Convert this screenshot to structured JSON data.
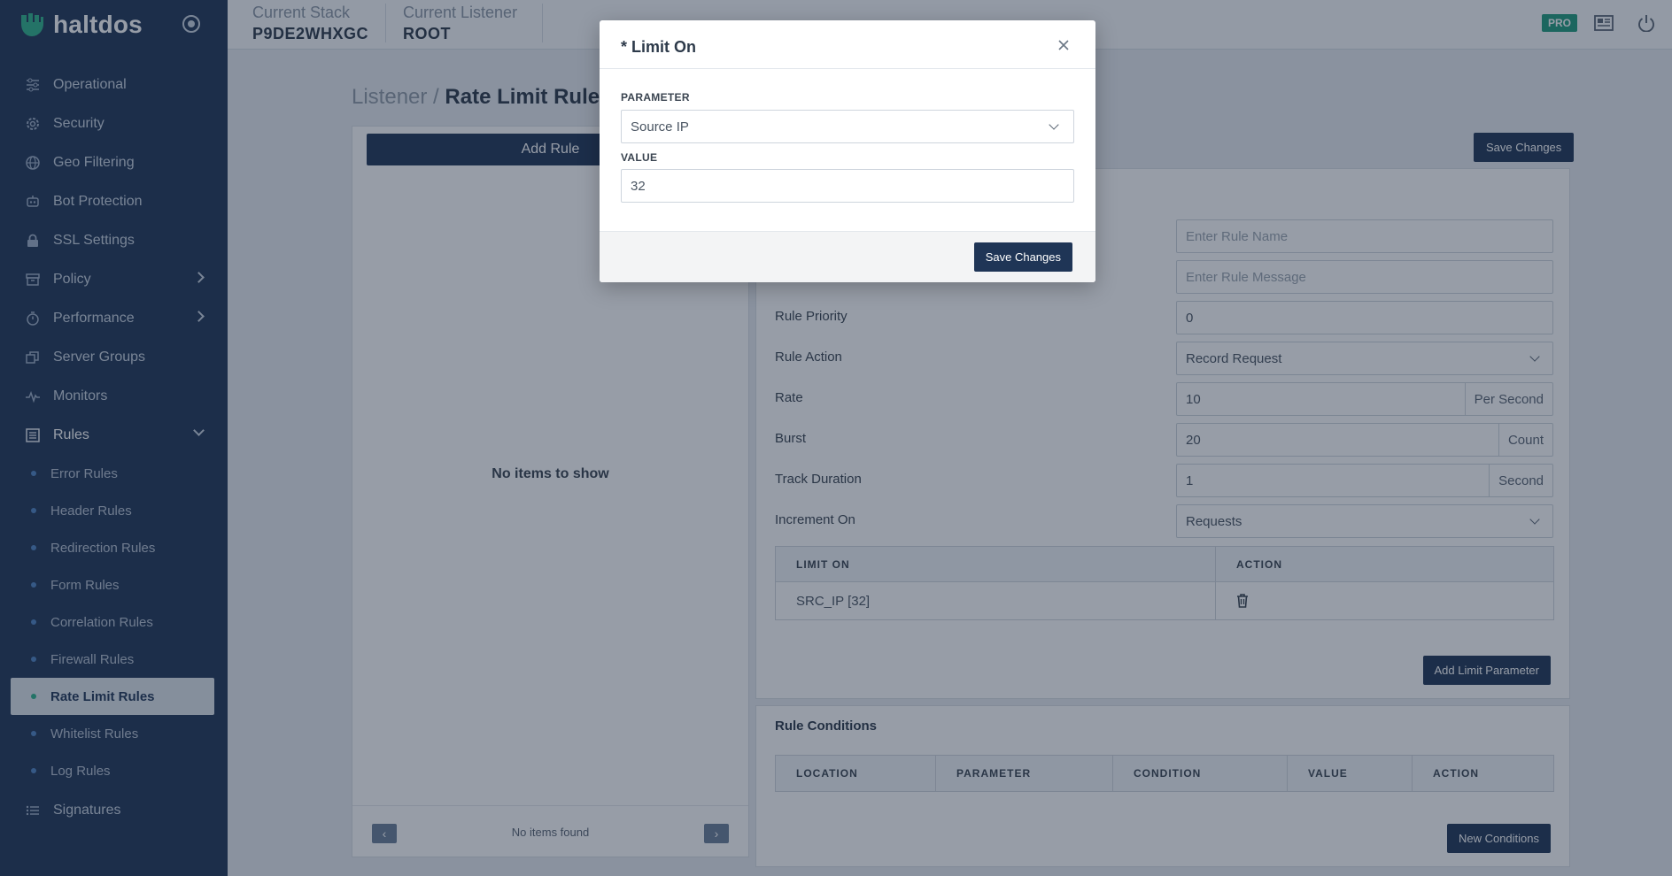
{
  "brand": {
    "name": "haltdos"
  },
  "header": {
    "stack_label": "Current Stack",
    "stack_value": "P9DE2WHXGC",
    "listener_label": "Current Listener",
    "listener_value": "ROOT",
    "badge": "PRO"
  },
  "sidebar": {
    "items": [
      {
        "label": "Operational",
        "icon": "sliders-icon"
      },
      {
        "label": "Security",
        "icon": "gear-icon"
      },
      {
        "label": "Geo Filtering",
        "icon": "globe-icon"
      },
      {
        "label": "Bot Protection",
        "icon": "bot-icon"
      },
      {
        "label": "SSL Settings",
        "icon": "lock-icon"
      },
      {
        "label": "Policy",
        "icon": "archive-icon"
      },
      {
        "label": "Performance",
        "icon": "stopwatch-icon"
      },
      {
        "label": "Server Groups",
        "icon": "copy-icon"
      },
      {
        "label": "Monitors",
        "icon": "activity-icon"
      },
      {
        "label": "Rules",
        "icon": "list-box-icon"
      }
    ],
    "rules_sub": [
      "Error Rules",
      "Header Rules",
      "Redirection Rules",
      "Form Rules",
      "Correlation Rules",
      "Firewall Rules",
      "Rate Limit Rules",
      "Whitelist Rules",
      "Log Rules"
    ],
    "signatures": "Signatures"
  },
  "main": {
    "breadcrumb_parent": "Listener /",
    "breadcrumb_current": "Rate Limit Rules",
    "add_rule": "Add Rule",
    "empty": "No items to show",
    "pager_text": "No items found",
    "save_changes": "Save Changes",
    "form": {
      "rule_name_placeholder": "Enter Rule Name",
      "rule_message_placeholder": "Enter Rule Message",
      "priority_label": "Rule Priority",
      "priority_value": "0",
      "action_label": "Rule Action",
      "action_value": "Record Request",
      "rate_label": "Rate",
      "rate_value": "10",
      "rate_unit": "Per Second",
      "burst_label": "Burst",
      "burst_value": "20",
      "burst_unit": "Count",
      "track_label": "Track Duration",
      "track_value": "1",
      "track_unit": "Second",
      "increment_label": "Increment On",
      "increment_value": "Requests"
    },
    "limit_table": {
      "headers": [
        "LIMIT ON",
        "ACTION"
      ],
      "rows": [
        {
          "limit_on": "SRC_IP [32]"
        }
      ]
    },
    "add_limit": "Add Limit Parameter",
    "conditions_title": "Rule Conditions",
    "conditions_headers": [
      "LOCATION",
      "PARAMETER",
      "CONDITION",
      "VALUE",
      "ACTION"
    ],
    "new_conditions": "New Conditions"
  },
  "modal": {
    "title": "* Limit On",
    "parameter_label": "PARAMETER",
    "parameter_value": "Source IP",
    "value_label": "VALUE",
    "value_value": "32",
    "save": "Save Changes"
  },
  "colors": {
    "sidebar": "#1f3556",
    "accent": "#1f9b7d",
    "primary_button": "#1f3556"
  }
}
